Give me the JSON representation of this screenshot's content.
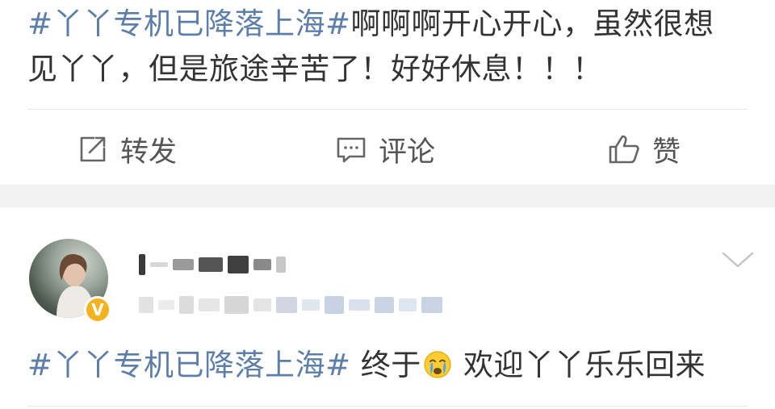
{
  "posts": [
    {
      "hashtag": "#丫丫专机已降落上海#",
      "text_line1": "啊啊啊开心开心，虽然很想",
      "text_line2": "见丫丫，但是旅途辛苦了！好好休息！！！"
    },
    {
      "hashtag": "#丫丫专机已降落上海#",
      "text_before_emoji": " 终于",
      "emoji": "crying-face-emoji",
      "text_after_emoji": " 欢迎丫丫乐乐回来"
    }
  ],
  "actions": {
    "repost_label": "转发",
    "comment_label": "评论",
    "like_label": "赞"
  },
  "author": {
    "verified_mark": "V",
    "verified_color": "#f5b21f"
  },
  "colors": {
    "hashtag": "#5c7ea9",
    "text": "#333333",
    "action_text": "#555555",
    "separator_band": "#f2f2f2"
  },
  "icons": {
    "repost": "share-edit-icon",
    "comment": "comment-icon",
    "like": "thumbs-up-icon",
    "dropdown": "chevron-down-icon"
  }
}
